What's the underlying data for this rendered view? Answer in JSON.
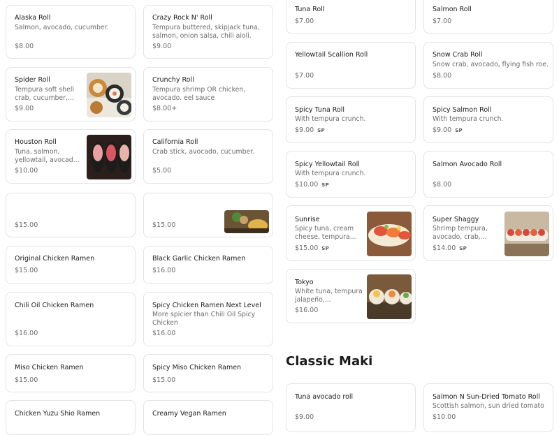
{
  "left_items": [
    {
      "name": "Alaska Roll",
      "desc": "Salmon, avocado, cucumber.",
      "price": "$8.00"
    },
    {
      "name": "Crazy Rock N' Roll",
      "desc": "Tempura buttered, skipjack tuna, salmon, onion salsa, chili aioli.",
      "price": "$9.00"
    },
    {
      "name": "Spider Roll",
      "desc": "Tempura soft shell crab, cucumber,...",
      "price": "$9.00"
    },
    {
      "name": "Crunchy Roll",
      "desc": "Tempura shrimp OR chicken, avocado. eel sauce",
      "price": "$8.00+"
    },
    {
      "name": "Houston Roll",
      "desc": "Tuna, salmon, yellowtail, avocad...",
      "price": "$10.00"
    },
    {
      "name": "California Roll",
      "desc": "Crab stick, avocado, cucumber.",
      "price": "$5.00"
    },
    {
      "price": "$15.00"
    },
    {
      "price": "$15.00"
    },
    {
      "name": "Original Chicken Ramen",
      "price": "$15.00"
    },
    {
      "name": "Black Garlic Chicken Ramen",
      "price": "$16.00"
    },
    {
      "name": "Chili Oil Chicken Ramen",
      "price": "$16.00"
    },
    {
      "name": "Spicy Chicken Ramen Next Level",
      "desc": "More spicier than Chili Oil Spicy Chicken",
      "price": "$16.00"
    },
    {
      "name": "Miso Chicken Ramen",
      "price": "$15.00"
    },
    {
      "name": "Spicy Miso Chicken Ramen",
      "price": "$15.00"
    },
    {
      "name": "Chicken Yuzu Shio Ramen"
    },
    {
      "name": "Creamy Vegan Ramen"
    }
  ],
  "right_items": [
    {
      "name": "Tuna Roll",
      "price": "$7.00"
    },
    {
      "name": "Salmon Roll",
      "price": "$7.00"
    },
    {
      "name": "Yellowtail Scallion Roll",
      "price": "$7.00"
    },
    {
      "name": "Snow Crab Roll",
      "desc": "Snow crab, avocado, flying fish roe.",
      "price": "$8.00"
    },
    {
      "name": "Spicy Tuna Roll",
      "desc": "With tempura crunch.",
      "price": "$9.00",
      "badge": "SP"
    },
    {
      "name": "Spicy Salmon Roll",
      "desc": "With tempura crunch.",
      "price": "$9.00",
      "badge": "SP"
    },
    {
      "name": "Spicy Yellowtail Roll",
      "desc": "With tempura crunch.",
      "price": "$10.00",
      "badge": "SP"
    },
    {
      "name": "Salmon Avocado Roll",
      "price": "$8.00"
    },
    {
      "name": "Sunrise",
      "desc": "Spicy tuna, cream cheese, tempura...",
      "price": "$15.00",
      "badge": "SP"
    },
    {
      "name": "Super Shaggy",
      "desc": "Shrimp tempura, avocado, crab,...",
      "price": "$14.00",
      "badge": "SP"
    },
    {
      "name": "Tokyo",
      "desc": "White tuna, tempura jalapeño,...",
      "price": "$16.00"
    }
  ],
  "section": {
    "title": "Classic Maki"
  },
  "maki_items": [
    {
      "name": "Tuna avocado roll",
      "price": "$9.00"
    },
    {
      "name": "Salmon N Sun-Dried Tomato Roll",
      "desc": "Scottish salmon, sun dried tomato",
      "price": "$10.00"
    }
  ],
  "colors": {
    "card_border": "#e3e3e3",
    "muted_text": "#6b6b6b",
    "title_text": "#1b1b1b"
  },
  "icons": {
    "photo": "food-photo"
  }
}
